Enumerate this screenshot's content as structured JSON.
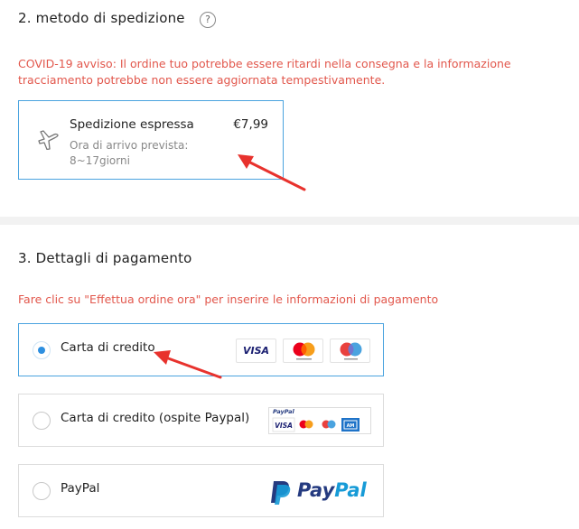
{
  "shipping": {
    "title": "2. metodo di spedizione",
    "help_icon": "?",
    "notice": "COVID-19 avviso: Il ordine tuo potrebbe essere ritardi nella consegna e la informazione tracciamento potrebbe non essere aggiornata tempestivamente.",
    "option": {
      "icon": "airplane-icon",
      "name": "Spedizione espressa",
      "price": "€7,99",
      "eta_label": "Ora di arrivo prevista:",
      "eta_value": "8~17giorni"
    }
  },
  "payment": {
    "title": "3. Dettagli di pagamento",
    "notice": "Fare clic su \"Effettua ordine ora\" per inserire le informazioni di pagamento",
    "options": [
      {
        "label": "Carta di credito",
        "selected": true,
        "logos": [
          "VISA",
          "mastercard",
          "maestro"
        ]
      },
      {
        "label": "Carta di credito (ospite Paypal)",
        "selected": false,
        "logos": [
          "PayPal",
          "VISA",
          "mastercard",
          "maestro",
          "amex"
        ]
      },
      {
        "label": "PayPal",
        "selected": false,
        "logos": [
          "PayPal"
        ]
      }
    ],
    "paypal_word_pay": "Pay",
    "paypal_word_pal": "Pal",
    "mini_paypal": "PayPal",
    "visa_text": "VISA"
  },
  "colors": {
    "accent": "#4aa3df",
    "notice_red": "#e2574c",
    "annotation_arrow": "#e8322d"
  }
}
